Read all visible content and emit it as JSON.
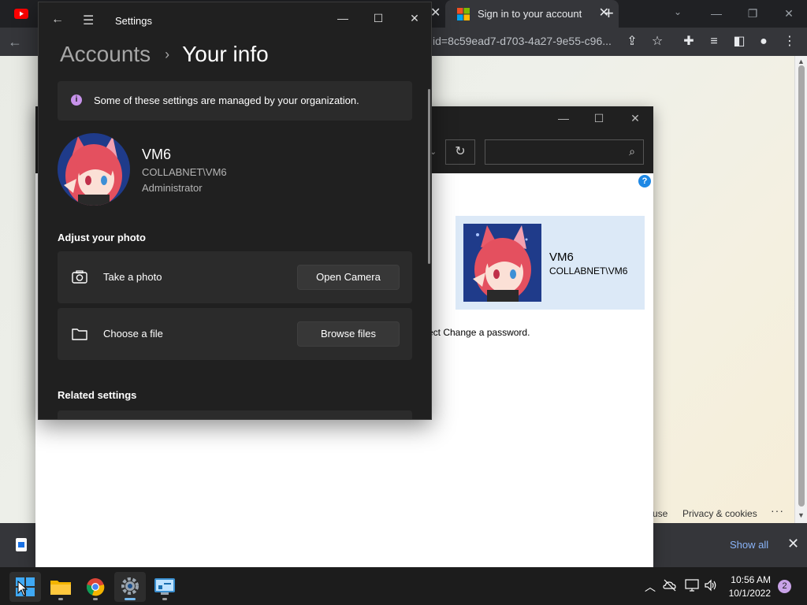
{
  "chrome": {
    "tabs": [
      {
        "title": "",
        "icon": "youtube-icon",
        "active": false
      },
      {
        "title": "Sign in to your account",
        "icon": "microsoft-icon",
        "active": true
      }
    ],
    "address": "id=8c59ead7-d703-4a27-9e55-c96...",
    "downloads_bar": {
      "show_all_label": "Show all"
    },
    "footer": {
      "terms_fragment": "use",
      "privacy": "Privacy & cookies",
      "more": "···"
    }
  },
  "control_panel": {
    "user_card": {
      "name": "VM6",
      "domain": "COLLABNET\\VM6"
    },
    "instruction_fragment": "ect Change a password."
  },
  "settings": {
    "window_title": "Settings",
    "breadcrumb": {
      "parent": "Accounts",
      "current": "Your info"
    },
    "notice": "Some of these settings are managed by your organization.",
    "user": {
      "name": "VM6",
      "domain": "COLLABNET\\VM6",
      "role": "Administrator"
    },
    "adjust_photo_heading": "Adjust your photo",
    "options": [
      {
        "label": "Take a photo",
        "button": "Open Camera",
        "icon": "camera-icon"
      },
      {
        "label": "Choose a file",
        "button": "Browse files",
        "icon": "folder-icon"
      }
    ],
    "related_heading": "Related settings"
  },
  "taskbar": {
    "apps": [
      "start",
      "file-explorer",
      "chrome",
      "settings",
      "control-panel"
    ],
    "clock": {
      "time": "10:56 AM",
      "date": "10/1/2022"
    },
    "notification_count": "2"
  },
  "colors": {
    "accent": "#76b9ed",
    "settings_bg": "#202020",
    "card_bg": "#2b2b2b",
    "notice_icon": "#c792ea"
  }
}
